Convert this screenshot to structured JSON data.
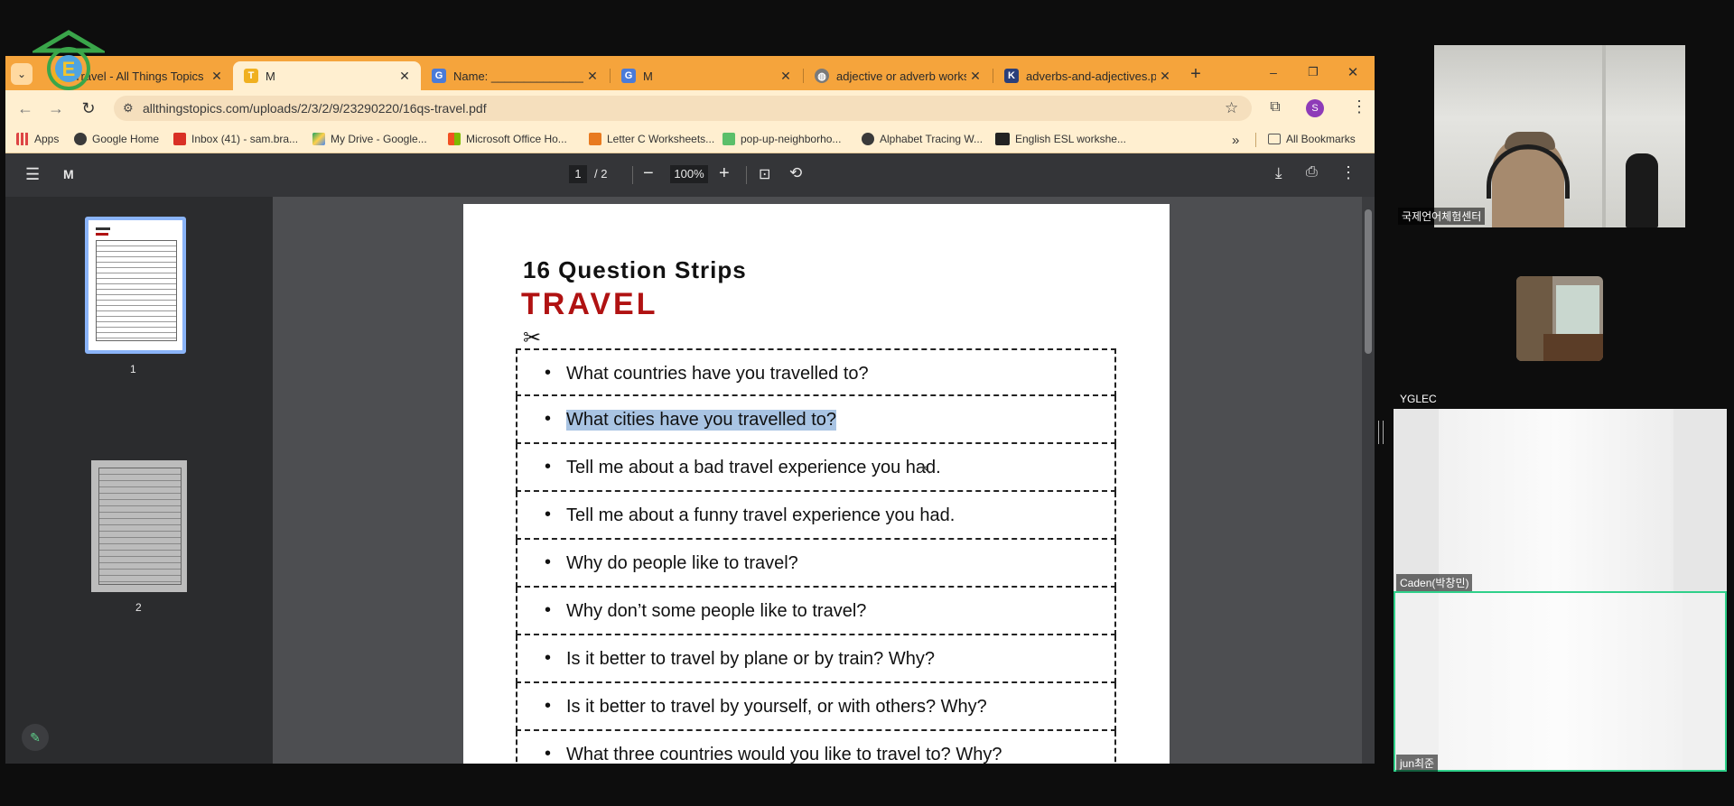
{
  "browser": {
    "tabs": [
      {
        "title": "Travel - All Things Topics",
        "favicon": "T",
        "active": false
      },
      {
        "title": "M",
        "favicon": "T",
        "active": true
      },
      {
        "title": "Name: ________________",
        "favicon": "G",
        "active": false
      },
      {
        "title": "M",
        "favicon": "G",
        "active": false
      },
      {
        "title": "adjective or adverb worksh",
        "favicon": "globe",
        "active": false
      },
      {
        "title": "adverbs-and-adjectives.pn",
        "favicon": "K",
        "active": false
      }
    ],
    "new_tab": "+",
    "window_controls": {
      "minimize": "–",
      "restore": "❐",
      "close": "✕"
    },
    "url": "allthingstopics.com/uploads/2/3/2/9/23290220/16qs-travel.pdf",
    "profile_initial": "S",
    "bookmarks": [
      {
        "label": "Apps"
      },
      {
        "label": "Google Home"
      },
      {
        "label": "Inbox (41) - sam.bra..."
      },
      {
        "label": "My Drive - Google..."
      },
      {
        "label": "Microsoft Office Ho..."
      },
      {
        "label": "Letter C Worksheets..."
      },
      {
        "label": "pop-up-neighborho..."
      },
      {
        "label": "Alphabet Tracing W..."
      },
      {
        "label": "English ESL workshe..."
      }
    ],
    "bookmarks_overflow": "»",
    "all_bookmarks": "All Bookmarks"
  },
  "pdf": {
    "doc_title": "M",
    "page_current": "1",
    "page_total": "/ 2",
    "zoom": "100%",
    "thumbnails": [
      {
        "label": "1"
      },
      {
        "label": "2"
      }
    ],
    "heading": "16 Question Strips",
    "subheading": "TRAVEL",
    "questions": [
      "What countries have you travelled to?",
      "What cities have you travelled to?",
      "Tell me about a bad travel experience you had.",
      "Tell me about a funny travel experience you had.",
      "Why do people like to travel?",
      "Why don’t some people like to travel?",
      "Is it better to travel by plane or by train?  Why?",
      "Is it better to travel by yourself, or with others?  Why?",
      "What three countries would you like to travel to?  Why?"
    ],
    "selected_question_index": 1
  },
  "meet": {
    "participants": [
      {
        "name": "국제언어체험센터"
      },
      {
        "name": "YGLEC"
      },
      {
        "name": "Caden(박창민)"
      },
      {
        "name": "jun최준"
      }
    ]
  },
  "colors": {
    "tab_bar": "#f5a43c",
    "toolbar": "#ffefd0",
    "title_red": "#b01212",
    "highlight": "#a9c4e3",
    "active_speaker": "#2fd08a"
  }
}
